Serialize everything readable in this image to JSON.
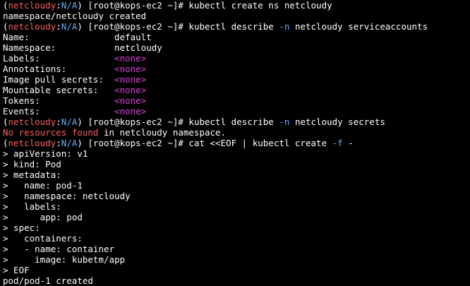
{
  "prompt": {
    "open": "(",
    "context": "netcloudy",
    "sep": ":",
    "namespace": "N/A",
    "close": ")",
    "host": " [root@kops-ec2 ~]# "
  },
  "lines": {
    "l1_cmd": "kubectl create ns netcloudy",
    "l2_out": "namespace/netcloudy created",
    "l3_cmd_a": "kubectl describe ",
    "l3_flag": "-n",
    "l3_cmd_b": " netcloudy serviceaccounts",
    "l4_key": "Name:                ",
    "l4_val": "default",
    "l5_key": "Namespace:           ",
    "l5_val": "netcloudy",
    "l6_key": "Labels:              ",
    "l7_key": "Annotations:         ",
    "l8_key": "Image pull secrets:  ",
    "l9_key": "Mountable secrets:   ",
    "l10_key": "Tokens:              ",
    "l11_key": "Events:              ",
    "none_val": "<none>",
    "l12_cmd_a": "kubectl describe ",
    "l12_flag": "-n",
    "l12_cmd_b": " netcloudy secrets",
    "l13_err": "No resources found",
    "l13_rest": " in netcloudy namespace.",
    "l14_cmd_a": "cat <<EOF | kubectl create ",
    "l14_flag": "-f",
    "l14_cmd_b": " -",
    "y1": "> apiVersion: v1",
    "y2": "> kind: Pod",
    "y3": "> metadata:",
    "y4": ">   name: pod-1",
    "y5": ">   namespace: netcloudy",
    "y6": ">   labels:",
    "y7": ">      app: pod",
    "y8": "> spec:",
    "y9": ">   containers:",
    "y10": ">   - name: container",
    "y11": ">     image: kubetm/app",
    "y12": "> EOF",
    "final": "pod/pod-1 created"
  },
  "colors": {
    "background": "#000000",
    "text": "#ffffff",
    "context": "#ff5f5f",
    "namespace": "#5fafff",
    "none": "#e040e0",
    "error": "#ff5f5f"
  }
}
